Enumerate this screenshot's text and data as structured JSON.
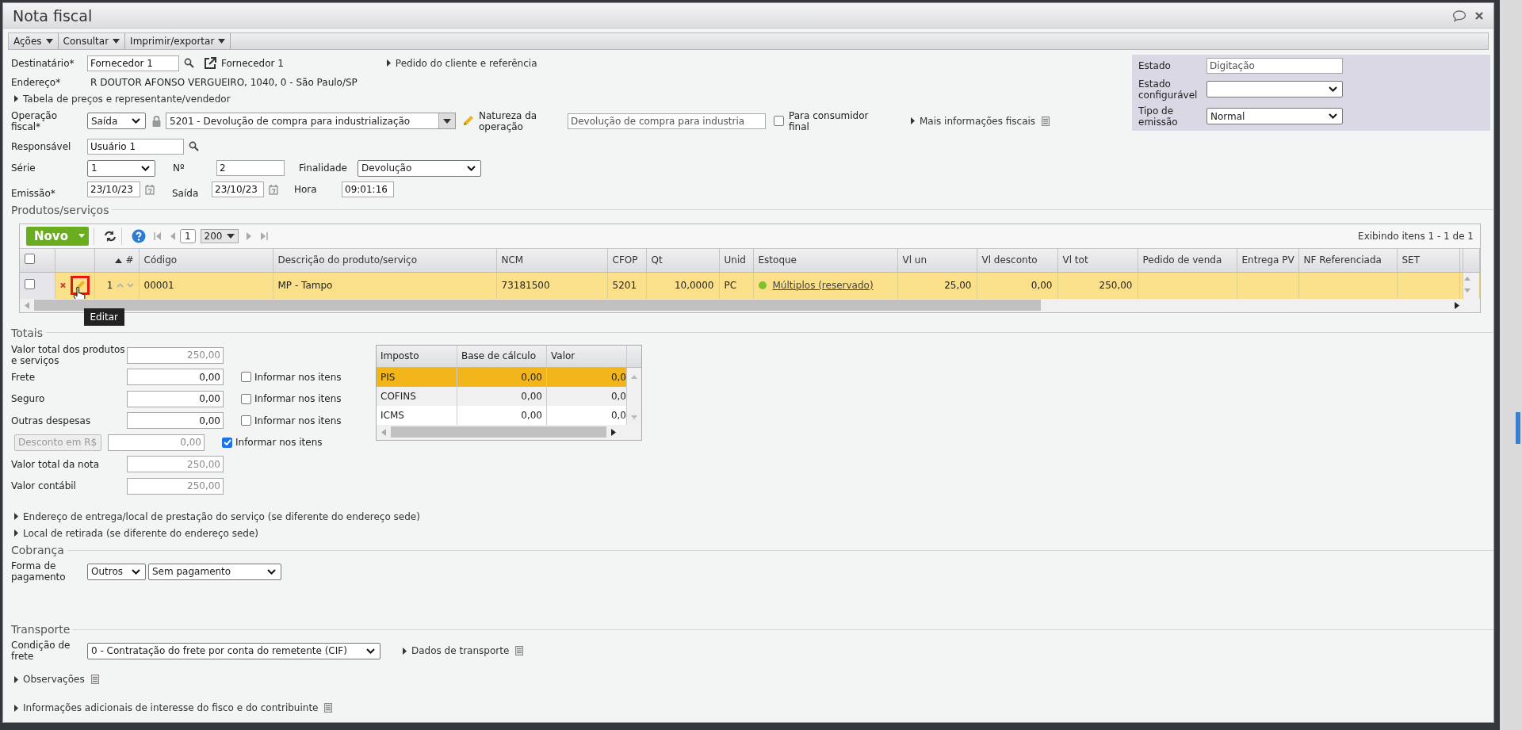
{
  "window": {
    "title": "Nota fiscal"
  },
  "menu": [
    "Ações",
    "Consultar",
    "Imprimir/exportar"
  ],
  "form": {
    "destinatario": {
      "label": "Destinatário*",
      "value": "Fornecedor 1",
      "link": "Fornecedor 1"
    },
    "pedido_link": "Pedido do cliente e referência",
    "endereco": {
      "label": "Endereço*",
      "value": "R DOUTOR AFONSO VERGUEIRO, 1040, 0 - São Paulo/SP"
    },
    "tabela_link": "Tabela de preços e representante/vendedor",
    "operacao": {
      "label": "Operação fiscal*",
      "tipo": "Saída",
      "cfop": "5201 - Devolução de compra para industrialização"
    },
    "natureza": {
      "label": "Natureza da operação",
      "value": "Devolução de compra para industria"
    },
    "consumidor_final": {
      "label": "Para consumidor final",
      "checked": false
    },
    "mais_info_link": "Mais informações fiscais",
    "responsavel": {
      "label": "Responsável",
      "value": "Usuário 1"
    },
    "serie": {
      "label": "Série",
      "value": "1"
    },
    "numero": {
      "label": "Nº",
      "value": "2"
    },
    "finalidade": {
      "label": "Finalidade",
      "value": "Devolução"
    },
    "emissao": {
      "label": "Emissão*",
      "value": "23/10/23"
    },
    "saida": {
      "label": "Saída",
      "value": "23/10/23"
    },
    "hora": {
      "label": "Hora",
      "value": "09:01:16"
    }
  },
  "status_panel": {
    "estado": {
      "label": "Estado",
      "value": "Digitação"
    },
    "estado_configuravel": {
      "label": "Estado configurável"
    },
    "tipo_emissao": {
      "label": "Tipo de emissão",
      "value": "Normal"
    }
  },
  "products": {
    "title": "Produtos/serviços",
    "new_button": "Novo",
    "select_all_checked": false,
    "page": "1",
    "page_size": "200",
    "summary": "Exibindo itens 1 - 1 de 1",
    "tooltip": "Editar",
    "columns": [
      "#",
      "Código",
      "Descrição do produto/serviço",
      "NCM",
      "CFOP",
      "Qt",
      "Unid",
      "Estoque",
      "Vl un",
      "Vl desconto",
      "Vl tot",
      "Pedido de venda",
      "Entrega PV",
      "NF Referenciada",
      "SET"
    ],
    "rows": [
      {
        "checked": false,
        "selected": true,
        "color": "#7cc22a",
        "cells": [
          "1",
          "00001",
          "MP - Tampo",
          "73181500",
          "5201",
          "10,0000",
          "PC",
          "Múltiplos (reservado)",
          "25,00",
          "0,00",
          "250,00"
        ]
      }
    ]
  },
  "totals": {
    "title": "Totais",
    "rows": [
      {
        "kind": "field",
        "label": "Valor total dos produtos e serviços",
        "value": "250,00",
        "disabled": true
      },
      {
        "kind": "field",
        "label": "Frete",
        "value": "0,00",
        "disabled": false,
        "informar": {
          "label": "Informar nos itens",
          "checked": false
        }
      },
      {
        "kind": "field",
        "label": "Seguro",
        "value": "0,00",
        "disabled": false,
        "informar": {
          "label": "Informar nos itens",
          "checked": false
        }
      },
      {
        "kind": "field",
        "label": "Outras despesas",
        "value": "0,00",
        "disabled": false,
        "informar": {
          "label": "Informar nos itens",
          "checked": false
        }
      },
      {
        "kind": "select",
        "label": "Desconto em R$",
        "value": "0,00",
        "disabled": true,
        "informar": {
          "label": "Informar nos itens",
          "checked": true
        }
      },
      {
        "kind": "field",
        "label": "Valor total da nota",
        "value": "250,00",
        "disabled": true
      },
      {
        "kind": "field",
        "label": "Valor contábil",
        "value": "250,00",
        "disabled": true
      }
    ]
  },
  "taxes": {
    "columns": [
      "Imposto",
      "Base de cálculo",
      "Valor"
    ],
    "rows": [
      {
        "name": "PIS",
        "base": "0,00",
        "valor": "0,0",
        "selected": true
      },
      {
        "name": "COFINS",
        "base": "0,00",
        "valor": "0,0",
        "selected": false
      },
      {
        "name": "ICMS",
        "base": "0,00",
        "valor": "0,0",
        "selected": false
      }
    ]
  },
  "address_links": [
    "Endereço de entrega/local de prestação do serviço (se diferente do endereço sede)",
    "Local de retirada (se diferente do endereço sede)"
  ],
  "cobranca": {
    "title": "Cobrança",
    "label": "Forma de pagamento",
    "tipo": "Outros",
    "condicao": "Sem pagamento"
  },
  "transporte": {
    "title": "Transporte",
    "label": "Condição de frete",
    "value": "0 - Contratação do frete por conta do remetente (CIF)",
    "dados_link": "Dados de transporte"
  },
  "observacoes_link": "Observações",
  "info_link": "Informações adicionais de interesse do fisco e do contribuinte"
}
